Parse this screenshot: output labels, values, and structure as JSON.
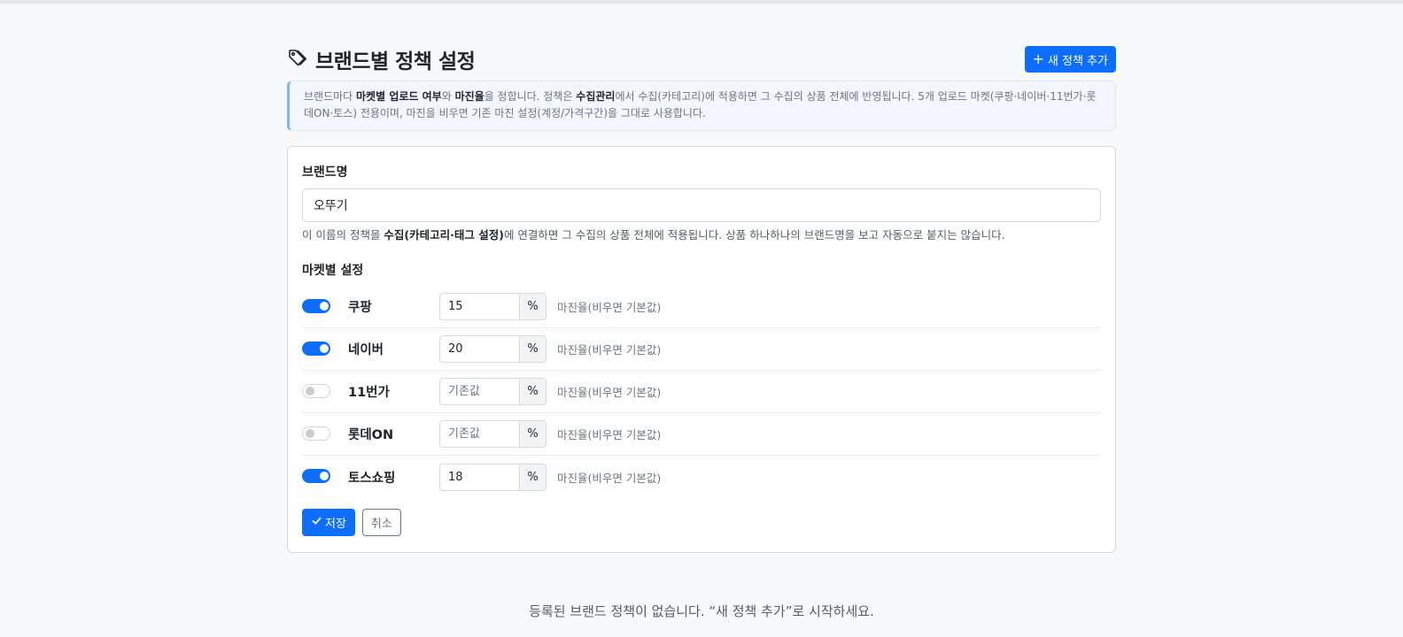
{
  "header": {
    "title": "브랜드별 정책 설정",
    "add_button": "새 정책 추가"
  },
  "info": {
    "t1": "브랜드마다 ",
    "b1": "마켓별 업로드 여부",
    "t2": "와 ",
    "b2": "마진율",
    "t3": "을 정합니다. 정책은 ",
    "b3": "수집관리",
    "t4": "에서 수집(카테고리)에 적용하면 그 수집의 상품 전체에 반영됩니다. 5개 업로드 마켓(쿠팡·네이버·11번가·롯데ON·토스) 전용이며, 마진을 비우면 기존 마진 설정(계정/가격구간)을 그대로 사용합니다."
  },
  "form": {
    "brand_label": "브랜드명",
    "brand_value": "오뚜기",
    "help_t1": "이 이름의 정책을 ",
    "help_b1": "수집(카테고리·태그 설정)",
    "help_t2": "에 연결하면 그 수집의 상품 전체에 적용됩니다. 상품 하나하나의 브랜드명을 보고 자동으로 붙지는 않습니다.",
    "market_label": "마켓별 설정",
    "markets": [
      {
        "name": "쿠팡",
        "enabled": true,
        "margin": "15",
        "placeholder": "기존값",
        "unit": "%",
        "hint": "마진율(비우면 기본값)"
      },
      {
        "name": "네이버",
        "enabled": true,
        "margin": "20",
        "placeholder": "기존값",
        "unit": "%",
        "hint": "마진율(비우면 기본값)"
      },
      {
        "name": "11번가",
        "enabled": false,
        "margin": "",
        "placeholder": "기존값",
        "unit": "%",
        "hint": "마진율(비우면 기본값)"
      },
      {
        "name": "롯데ON",
        "enabled": false,
        "margin": "",
        "placeholder": "기존값",
        "unit": "%",
        "hint": "마진율(비우면 기본값)"
      },
      {
        "name": "토스쇼핑",
        "enabled": true,
        "margin": "18",
        "placeholder": "기존값",
        "unit": "%",
        "hint": "마진율(비우면 기본값)"
      }
    ],
    "save_label": "저장",
    "cancel_label": "취소"
  },
  "empty_message": "등록된 브랜드 정책이 없습니다. “새 정책 추가”로 시작하세요.",
  "colors": {
    "primary": "#0d6efd",
    "info_border": "#7ab8f0",
    "background": "#f8f9fa"
  },
  "icons": {
    "title": "tag-icon",
    "add": "plus-icon",
    "save": "check-icon"
  }
}
